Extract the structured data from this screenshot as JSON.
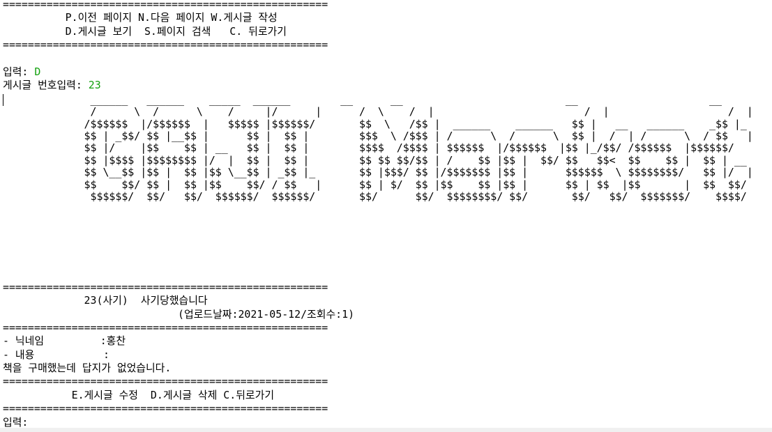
{
  "separator": "====================================================",
  "menu": {
    "line1": "          P.이전 페이지 N.다음 페이지 W.게시글 작성",
    "line2": "          D.게시글 보기  S.페이지 검색   C. 뒤로가기"
  },
  "input1": {
    "label": "입력: ",
    "value": "D"
  },
  "input2": {
    "label": "게시글 번호입력: ",
    "value": "23"
  },
  "ascii_art": "              ______   ______    _____  ______        __      __                          __                     __\n              /      \\  /      \\    /     |/      |      /  \\    /  |                        /  |                   /  |\n             /$$$$$$  |/$$$$$$  |   $$$$$ |$$$$$$/       $$  \\   /$$ |  ______    ______   $$ |   __   ______    _$$ |_\n             $$ | _$$/ $$ |__$$ |      $$ |  $$ |        $$$  \\ /$$$ | /      \\  /      \\  $$ |  /  | /      \\  / $$   |\n             $$ |/    |$$    $$ | __   $$ |  $$ |        $$$$  /$$$$ | $$$$$$  |/$$$$$$  |$$ |_/$$/ /$$$$$$  |$$$$$$/\n             $$ |$$$$ |$$$$$$$$ |/  |  $$ |  $$ |        $$ $$ $$/$$ | /    $$ |$$ |  $$/ $$   $$<  $$    $$ |  $$ | __\n             $$ \\__$$ |$$ |  $$ |$$ \\__$$ | _$$ |_       $$ |$$$/ $$ |/$$$$$$$ |$$ |      $$$$$$  \\ $$$$$$$$/   $$ |/  |\n             $$    $$/ $$ |  $$ |$$    $$/ / $$   |      $$ | $/  $$ |$$    $$ |$$ |      $$ | $$  |$$       |  $$  $$/\n              $$$$$$/  $$/   $$/  $$$$$$/  $$$$$$/       $$/      $$/  $$$$$$$$/ $$/       $$/   $$/  $$$$$$$/    $$$$/",
  "post": {
    "title_line": "             23(사기)  사기당했습니다",
    "meta_line": "                            (업로드날짜:2021-05-12/조회수:1)"
  },
  "detail": {
    "nickname_line": "- 닉네임         :홍찬",
    "content_label_line": "- 내용           :",
    "content": "책을 구매했는데 답지가 없었습니다."
  },
  "actions": {
    "line": "           E.게시글 수정  D.게시글 삭제 C.뒤로가기"
  },
  "prompt": {
    "label": "입력:"
  }
}
